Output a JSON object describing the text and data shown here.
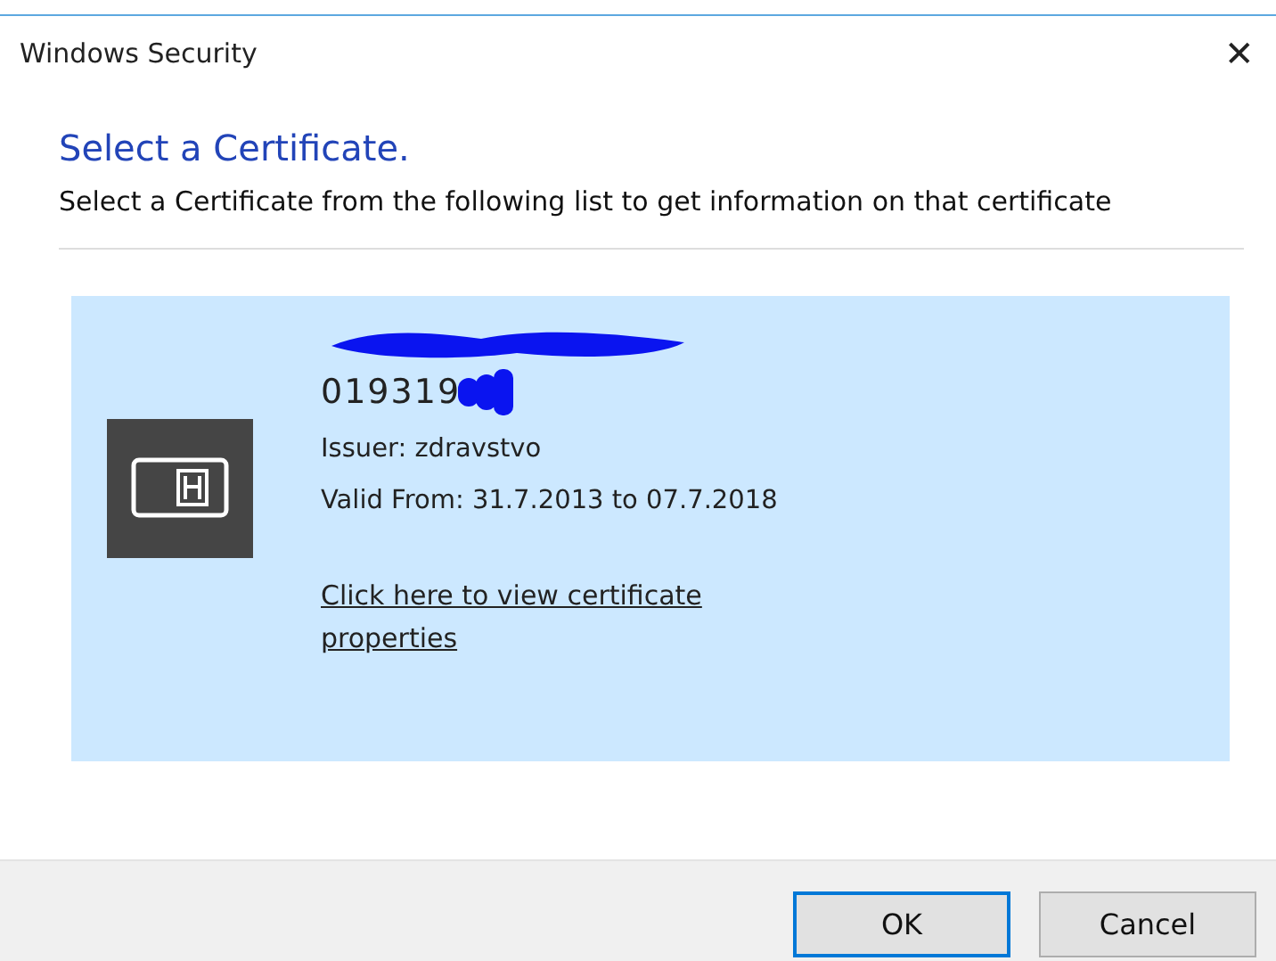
{
  "window": {
    "title": "Windows Security",
    "close": "✕"
  },
  "heading": "Select a Certificate.",
  "description": "Select a Certificate from the following list to get information on that certificate",
  "certificates": [
    {
      "serial": "019319",
      "issuer": "Issuer: zdravstvo",
      "valid": "Valid From: 31.7.2013 to 07.7.2018",
      "link": "Click here to view certificate properties",
      "selected": true
    }
  ],
  "buttons": [
    {
      "label": "OK",
      "default": true
    },
    {
      "label": "Cancel",
      "default": false
    }
  ]
}
